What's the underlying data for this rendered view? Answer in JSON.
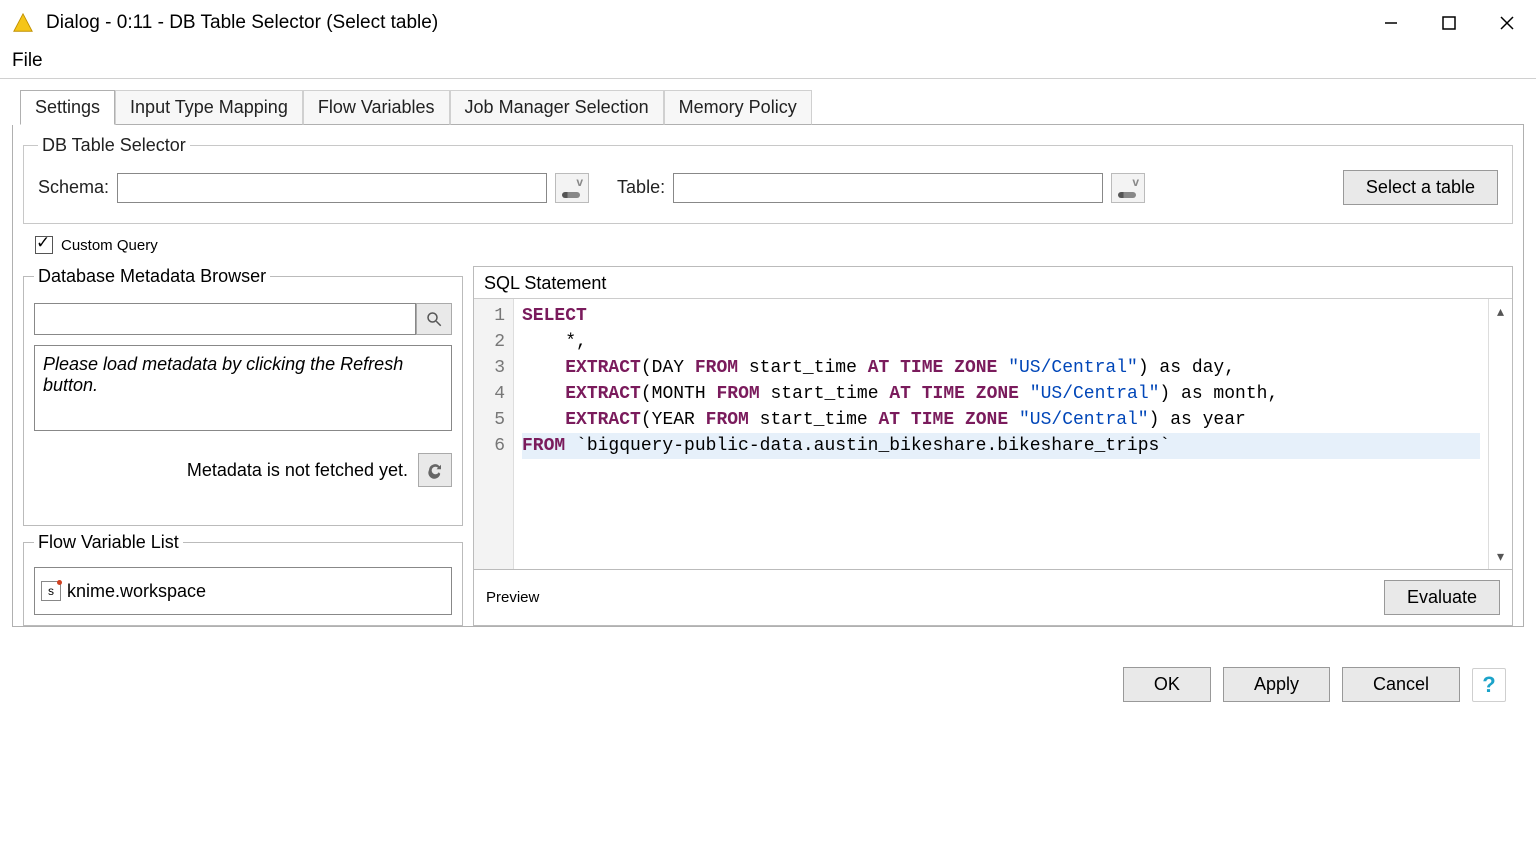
{
  "window": {
    "title": "Dialog - 0:11 - DB Table Selector (Select table)"
  },
  "menubar": {
    "file": "File"
  },
  "tabs": [
    {
      "label": "Settings",
      "active": true
    },
    {
      "label": "Input Type Mapping",
      "active": false
    },
    {
      "label": "Flow Variables",
      "active": false
    },
    {
      "label": "Job Manager Selection",
      "active": false
    },
    {
      "label": "Memory Policy",
      "active": false
    }
  ],
  "selector": {
    "legend": "DB Table Selector",
    "schema_label": "Schema:",
    "schema_value": "",
    "table_label": "Table:",
    "table_value": "",
    "select_table_btn": "Select a table"
  },
  "custom_query": {
    "label": "Custom Query",
    "checked": true
  },
  "metadata": {
    "legend": "Database Metadata Browser",
    "search_value": "",
    "message": "Please load metadata by clicking the Refresh button.",
    "status": "Metadata is not fetched yet."
  },
  "flowvar_list": {
    "legend": "Flow Variable List",
    "items": [
      {
        "badge": "s",
        "name": "knime.workspace"
      }
    ]
  },
  "sql": {
    "legend": "SQL Statement",
    "lines_count": 6,
    "raw": "SELECT\n    *,\n    EXTRACT(DAY FROM start_time AT TIME ZONE \"US/Central\") as day,\n    EXTRACT(MONTH FROM start_time AT TIME ZONE \"US/Central\") as month,\n    EXTRACT(YEAR FROM start_time AT TIME ZONE \"US/Central\") as year\nFROM `bigquery-public-data.austin_bikeshare.bikeshare_trips`"
  },
  "preview": {
    "label": "Preview",
    "evaluate_btn": "Evaluate"
  },
  "footer": {
    "ok": "OK",
    "apply": "Apply",
    "cancel": "Cancel"
  }
}
